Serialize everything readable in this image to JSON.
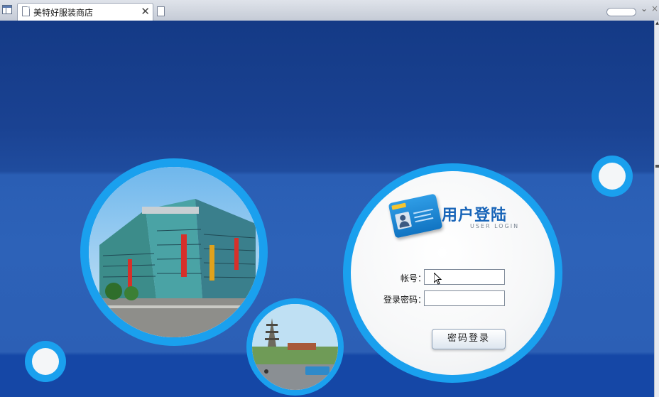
{
  "browser": {
    "tab_title": "美特好服装商店",
    "tab_close": "✕",
    "menu_chevron": "⌄",
    "close_glyph": "×"
  },
  "login": {
    "title": "用户登陆",
    "subtitle": "USER LOGIN",
    "account_label": "帐号：",
    "password_label": "登录密码：",
    "account_value": "",
    "password_value": "",
    "submit_label": "密码登录"
  },
  "colors": {
    "ring": "#1aa0ee",
    "background": "#1b3f8c",
    "title": "#1764b8"
  }
}
